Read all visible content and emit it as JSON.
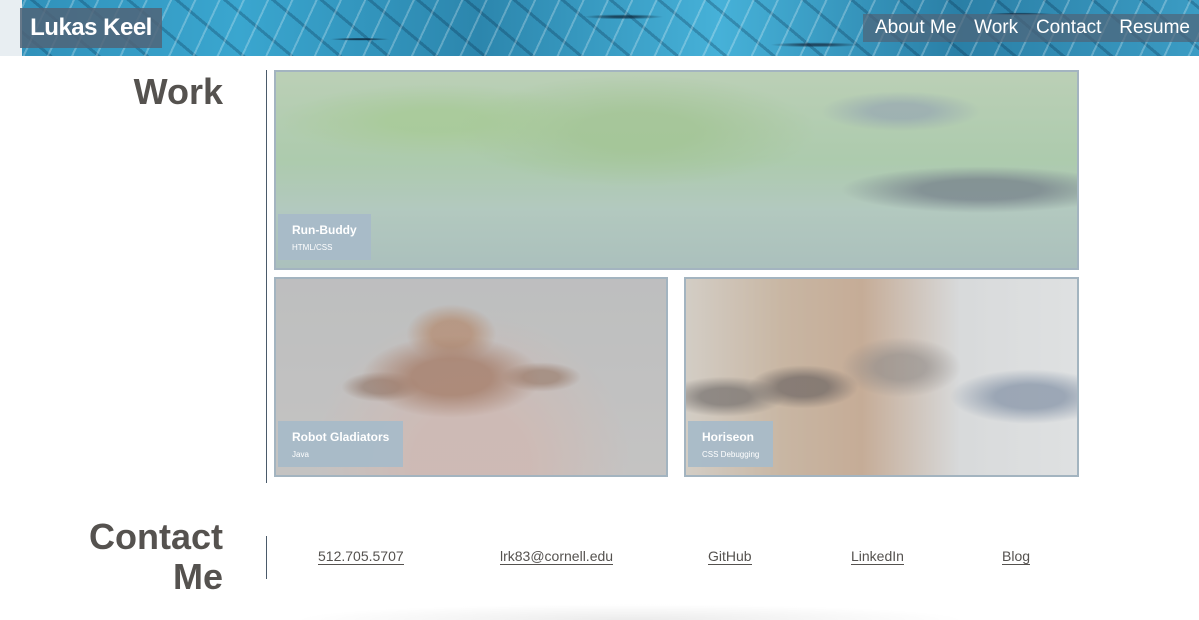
{
  "header": {
    "logo": "Lukas Keel",
    "nav": [
      "About Me",
      "Work",
      "Contact",
      "Resume"
    ]
  },
  "work": {
    "title": "Work",
    "projects": [
      {
        "name": "Run-Buddy",
        "tech": "HTML/CSS"
      },
      {
        "name": "Robot Gladiators",
        "tech": "Java"
      },
      {
        "name": "Horiseon",
        "tech": "CSS Debugging"
      }
    ]
  },
  "contact": {
    "title_line1": "Contact",
    "title_line2": "Me",
    "links": [
      "512.705.5707",
      "lrk83@cornell.edu",
      "GitHub",
      "LinkedIn",
      "Blog"
    ]
  },
  "colors": {
    "accent": "#a3b4c0",
    "text": "#55524f",
    "header_overlay": "#506478"
  }
}
